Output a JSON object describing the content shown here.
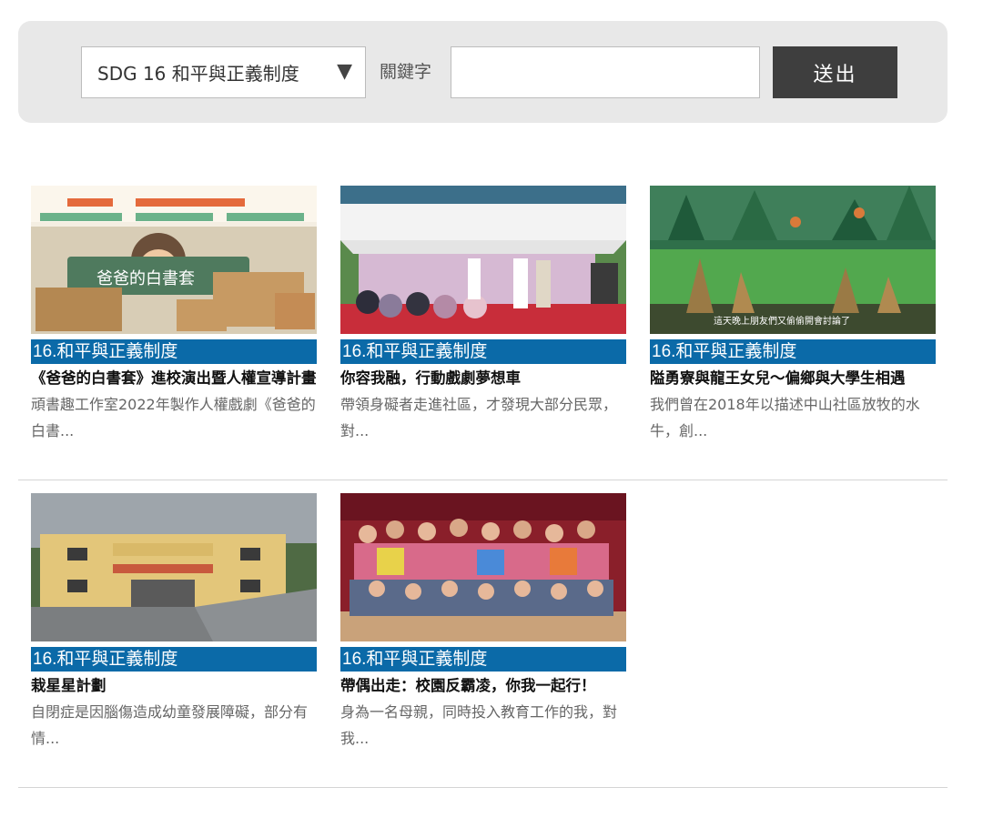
{
  "search": {
    "selected_sdg": "SDG 16 和平與正義制度",
    "select_arrow": "▼",
    "keyword_label": "關鍵字",
    "keyword_value": "",
    "keyword_placeholder": "",
    "submit_label": "送出"
  },
  "colors": {
    "tag_bg": "#0b6aa8",
    "panel_bg": "#e8e8e8",
    "button_bg": "#3e3e3e"
  },
  "cards": [
    {
      "tag": "16.和平與正義制度",
      "title": "《爸爸的白書套》進校演出暨人權宣導計畫",
      "desc": "頑書趣工作室2022年製作人權戲劇《爸爸的白書...",
      "thumb_text": "爸爸的白書套"
    },
    {
      "tag": "16.和平與正義制度",
      "title": "你容我融，行動戲劇夢想車",
      "desc": "帶領身礙者走進社區，才發現大部分民眾，對..."
    },
    {
      "tag": "16.和平與正義制度",
      "title": "隘勇寮與龍王女兒～偏鄉與大學生相遇",
      "desc": "我們曾在2018年以描述中山社區放牧的水牛，創...",
      "thumb_caption": "這天晚上朋友們又偷偷開會討論了"
    },
    {
      "tag": "16.和平與正義制度",
      "title": "栽星星計劃",
      "desc": "自閉症是因腦傷造成幼童發展障礙，部分有情..."
    },
    {
      "tag": "16.和平與正義制度",
      "title": "帶偶出走：校園反霸凌，你我一起行！",
      "desc": "身為一名母親，同時投入教育工作的我，對我..."
    }
  ]
}
